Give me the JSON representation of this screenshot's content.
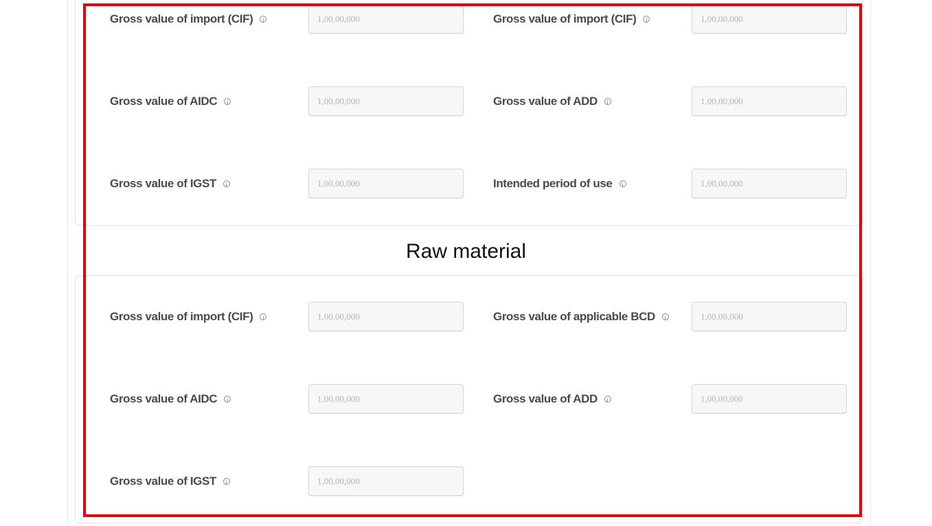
{
  "sections": {
    "raw_material_title": "Raw material"
  },
  "top_fields": [
    {
      "label": "Gross value of import (CIF)",
      "placeholder": "1,00,00,000"
    },
    {
      "label": "Gross value of import (CIF)",
      "placeholder": "1,00,00,000"
    },
    {
      "label": "Gross value of AIDC",
      "placeholder": "1,00,00,000"
    },
    {
      "label": "Gross value of ADD",
      "placeholder": "1,00,00,000"
    },
    {
      "label": "Gross value of IGST",
      "placeholder": "1,00,00,000"
    },
    {
      "label": "Intended period of use",
      "placeholder": "1,00,00,000"
    }
  ],
  "raw_material_fields": [
    {
      "label": "Gross value of import (CIF)",
      "placeholder": "1,00,00,000"
    },
    {
      "label": "Gross value of applicable BCD",
      "placeholder": "1,00,00,000"
    },
    {
      "label": "Gross value of AIDC",
      "placeholder": "1,00,00,000"
    },
    {
      "label": "Gross value of ADD",
      "placeholder": "1,00,00,000"
    },
    {
      "label": "Gross value of IGST",
      "placeholder": "1,00,00,000"
    }
  ],
  "colors": {
    "highlight": "#e3000f",
    "label_text": "#4a4a4a",
    "input_bg": "#f7f7f7"
  },
  "icons": {
    "field_help": "info-icon"
  }
}
